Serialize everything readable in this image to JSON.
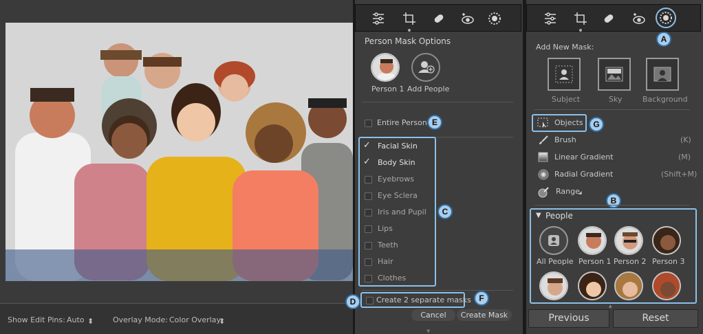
{
  "bottom_bar": {
    "show_edit_pins_label": "Show Edit Pins:",
    "show_edit_pins_value": "Auto",
    "overlay_mode_label": "Overlay Mode:",
    "overlay_mode_value": "Color Overlay"
  },
  "person_mask": {
    "title": "Person Mask Options",
    "person_label": "Person 1",
    "add_people_label": "Add People",
    "entire_person_label": "Entire Person",
    "parts": [
      {
        "label": "Facial Skin",
        "checked": true
      },
      {
        "label": "Body Skin",
        "checked": true
      },
      {
        "label": "Eyebrows",
        "checked": false
      },
      {
        "label": "Eye Sclera",
        "checked": false
      },
      {
        "label": "Iris and Pupil",
        "checked": false
      },
      {
        "label": "Lips",
        "checked": false
      },
      {
        "label": "Teeth",
        "checked": false
      },
      {
        "label": "Hair",
        "checked": false
      },
      {
        "label": "Clothes",
        "checked": false
      }
    ],
    "separate_masks_label": "Create 2 separate masks",
    "cancel_label": "Cancel",
    "create_mask_label": "Create Mask"
  },
  "masking": {
    "add_new_mask_label": "Add New Mask:",
    "subject_label": "Subject",
    "sky_label": "Sky",
    "background_label": "Background",
    "objects_label": "Objects",
    "brush_label": "Brush",
    "brush_shortcut": "(K)",
    "linear_label": "Linear Gradient",
    "linear_shortcut": "(M)",
    "radial_label": "Radial Gradient",
    "radial_shortcut": "(Shift+M)",
    "range_label": "Range",
    "people_header": "People",
    "people": [
      "All People",
      "Person 1",
      "Person 2",
      "Person 3"
    ],
    "previous_label": "Previous",
    "reset_label": "Reset"
  },
  "callouts": {
    "a": "A",
    "b": "B",
    "c": "C",
    "d": "D",
    "e": "E",
    "f": "F",
    "g": "G"
  },
  "icons": [
    "sliders-icon",
    "crop-icon",
    "bandage-icon",
    "redeye-icon",
    "masking-icon",
    "person-mask-icon",
    "add-person-icon",
    "subject-icon",
    "sky-icon",
    "background-icon",
    "objects-icon",
    "brush-icon",
    "linear-gradient-icon",
    "radial-gradient-icon",
    "range-icon"
  ]
}
